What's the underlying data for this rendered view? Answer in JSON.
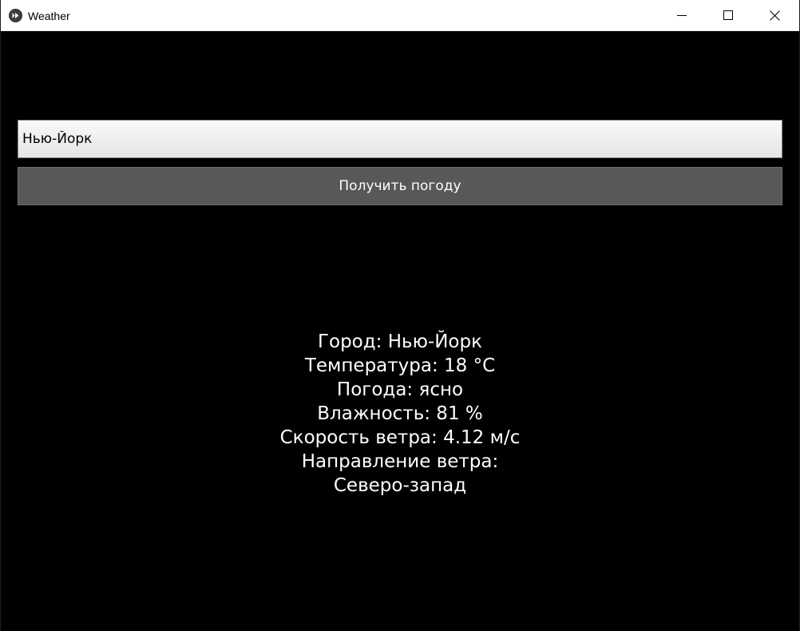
{
  "window": {
    "title": "Weather",
    "icon": "kivy-app-icon",
    "controls": [
      "minimize-icon",
      "maximize-icon",
      "close-icon"
    ]
  },
  "search": {
    "value": "Нью-Йорк"
  },
  "button": {
    "label": "Получить погоду"
  },
  "result": {
    "lines": [
      "Город: Нью-Йорк",
      "Температура: 18 °C",
      "Погода: ясно",
      "Влажность: 81 %",
      "Скорость ветра: 4.12 м/с",
      "Направление ветра:",
      "Северо-запад"
    ]
  },
  "colors": {
    "background": "#000000",
    "button": "#585858",
    "text": "#ffffff"
  }
}
